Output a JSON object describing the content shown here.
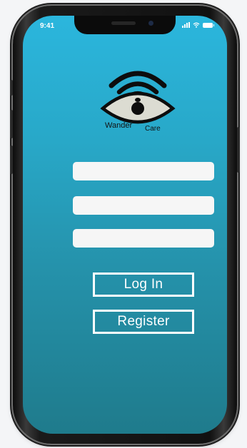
{
  "status_bar": {
    "time": "9:41",
    "icons": [
      "signal-icon",
      "wifi-icon",
      "battery-icon"
    ]
  },
  "logo": {
    "icon": "eye-wifi-logo-icon",
    "word_1": "Wander",
    "word_2": "Care"
  },
  "form": {
    "fields": [
      {
        "value": "",
        "placeholder": ""
      },
      {
        "value": "",
        "placeholder": ""
      },
      {
        "value": "",
        "placeholder": ""
      }
    ],
    "login_label": "Log In",
    "register_label": "Register"
  },
  "colors": {
    "screen_top": "#2bb6dd",
    "screen_bottom": "#1f7b8c",
    "field_bg": "#f6f6f6",
    "button_border": "#ffffff"
  }
}
